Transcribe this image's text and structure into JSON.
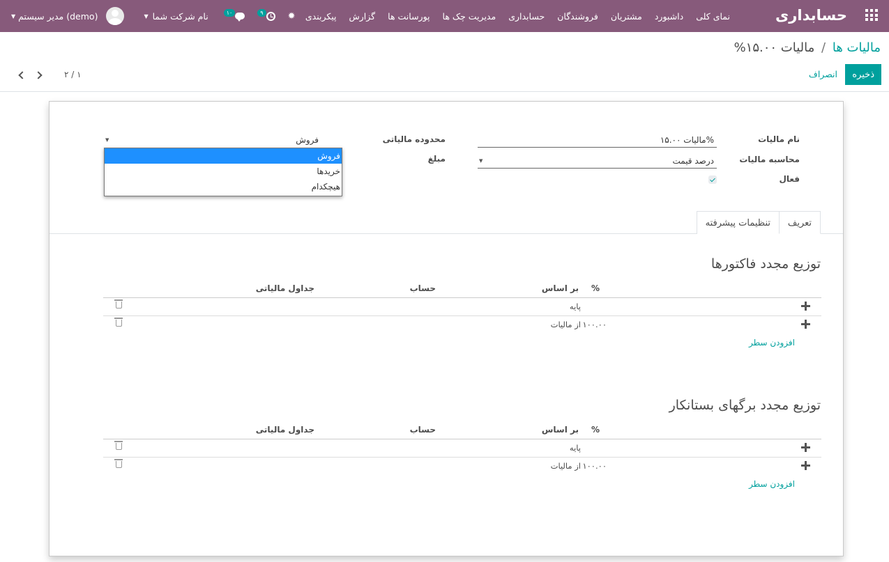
{
  "navbar": {
    "brand": "حسابداری",
    "menu": [
      "نمای کلی",
      "داشبورد",
      "مشتریان",
      "فروشندگان",
      "حسابداری",
      "مدیریت چک ها",
      "پورسانت ها",
      "گزارش",
      "پیکربندی"
    ],
    "company": "نام شرکت شما",
    "user": "مدیر سیستم (demo)",
    "activity_count": "۹",
    "message_count": "۱۰"
  },
  "breadcrumb": {
    "parent": "مالیات ها",
    "separator": "/",
    "current": "مالیات ۱۵.۰۰%"
  },
  "actions": {
    "save": "ذخیره",
    "discard": "انصراف"
  },
  "pager": {
    "counter": "۲ / ۱"
  },
  "form": {
    "tax_name_label": "نام مالیات",
    "tax_name_value": "مالیات ۱۵.۰۰%",
    "tax_computation_label": "محاسبه مالیات",
    "tax_computation_value": "درصد قیمت",
    "active_label": "فعال",
    "tax_scope_label": "محدوده مالیاتی",
    "tax_scope_value": "فروش",
    "amount_label": "مبلغ",
    "scope_options": [
      "فروش",
      "خریدها",
      "هیچکدام"
    ]
  },
  "tabs": {
    "definition": "تعریف",
    "advanced": "تنظیمات پیشرفته"
  },
  "sections": [
    {
      "title": "توزیع مجدد فاکتورها",
      "headers": {
        "percent": "%",
        "based_on": "بر اساس",
        "account": "حساب",
        "tax_grids": "جداول مالیاتی"
      },
      "rows": [
        {
          "percent": "",
          "based_on": "پایه"
        },
        {
          "percent": "۱۰۰.۰۰",
          "based_on": "از مالیات"
        }
      ],
      "add_line": "افزودن سطر"
    },
    {
      "title": "توزیع مجدد برگهای بستانکار",
      "headers": {
        "percent": "%",
        "based_on": "بر اساس",
        "account": "حساب",
        "tax_grids": "جداول مالیاتی"
      },
      "rows": [
        {
          "percent": "",
          "based_on": "پایه"
        },
        {
          "percent": "۱۰۰.۰۰",
          "based_on": "از مالیات"
        }
      ],
      "add_line": "افزودن سطر"
    }
  ]
}
